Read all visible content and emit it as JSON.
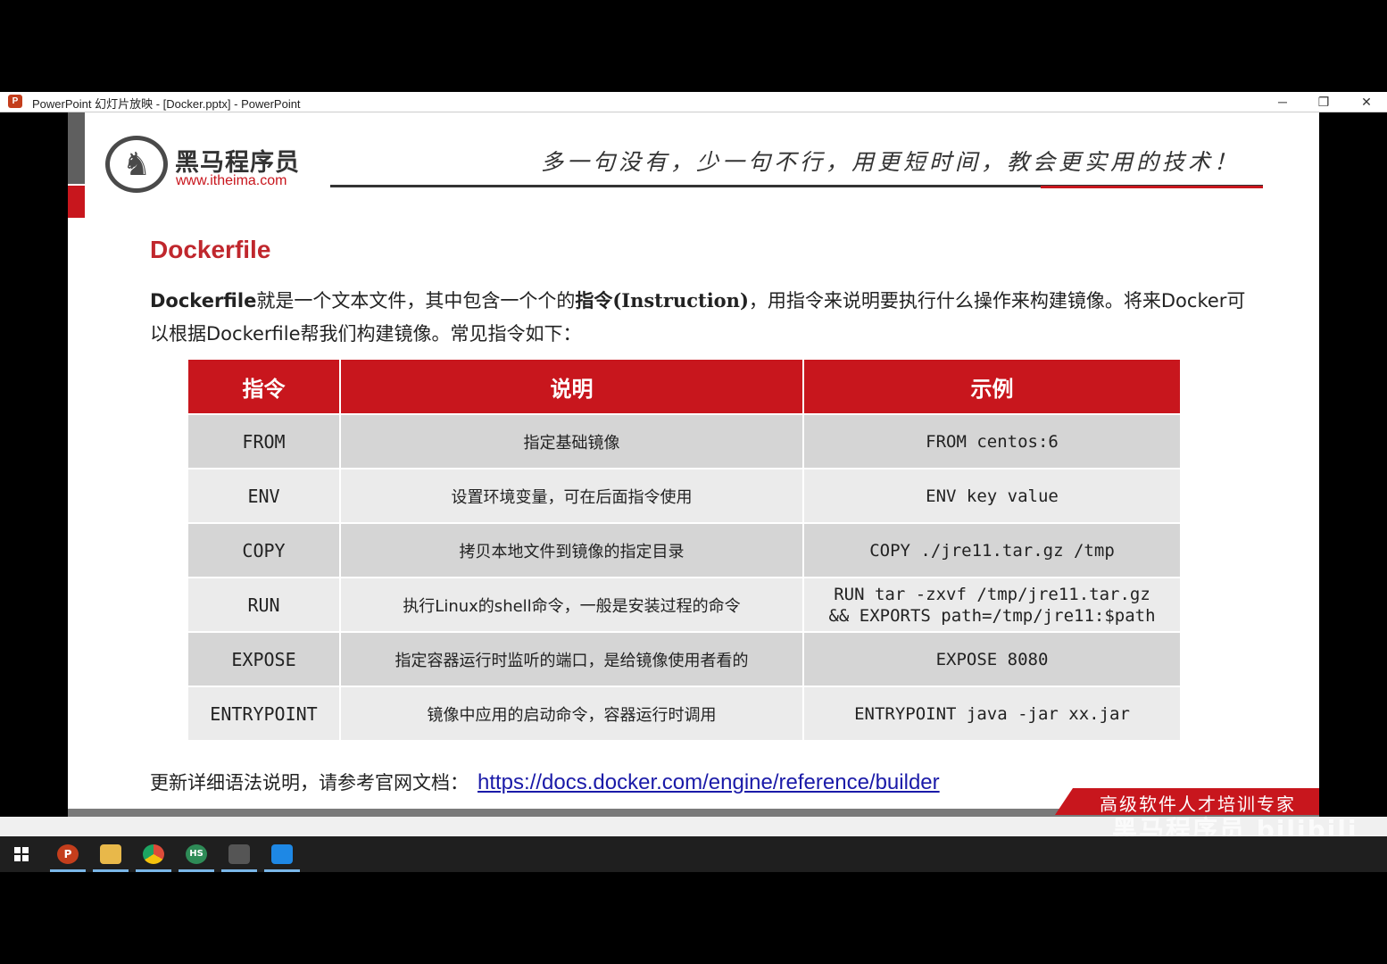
{
  "window": {
    "title": "PowerPoint 幻灯片放映 - [Docker.pptx] - PowerPoint",
    "app_icon": "P",
    "minimize": "─",
    "restore": "❐",
    "close": "✕"
  },
  "slide": {
    "logo": {
      "name_cn": "黑马程序员",
      "url": "www.itheima.com"
    },
    "slogan": "多一句没有，少一句不行，用更短时间，教会更实用的技术！",
    "heading": "Dockerfile",
    "intro": {
      "part1": "Dockerfile",
      "part2": "就是一个文本文件，其中包含一个个的",
      "part3": "指令",
      "part4": "(Instruction)",
      "part5": "，用指令来说明要执行什么操作来构建镜像。将来Docker可以根据Dockerfile帮我们构建镜像。常见指令如下："
    },
    "table": {
      "headers": [
        "指令",
        "说明",
        "示例"
      ],
      "rows": [
        {
          "cmd": "FROM",
          "desc": "指定基础镜像",
          "example": "FROM centos:6"
        },
        {
          "cmd": "ENV",
          "desc": "设置环境变量，可在后面指令使用",
          "example": "ENV key value"
        },
        {
          "cmd": "COPY",
          "desc": "拷贝本地文件到镜像的指定目录",
          "example": "COPY ./jre11.tar.gz /tmp"
        },
        {
          "cmd": "RUN",
          "desc": "执行Linux的shell命令，一般是安装过程的命令",
          "example": "RUN tar -zxvf /tmp/jre11.tar.gz\n&& EXPORTS path=/tmp/jre11:$path"
        },
        {
          "cmd": "EXPOSE",
          "desc": "指定容器运行时监听的端口，是给镜像使用者看的",
          "example": "EXPOSE 8080"
        },
        {
          "cmd": "ENTRYPOINT",
          "desc": "镜像中应用的启动命令，容器运行时调用",
          "example": "ENTRYPOINT java -jar xx.jar"
        }
      ]
    },
    "footer": {
      "note": "更新详细语法说明，请参考官网文档：",
      "link": "https://docs.docker.com/engine/reference/builder"
    },
    "banner": "高级软件人才培训专家"
  },
  "overlay": {
    "watermark": "黑马程序员 bilibili"
  },
  "taskbar": {
    "items": [
      {
        "icon": "powerpoint-icon",
        "label": "P",
        "color": "#c43e1c"
      },
      {
        "icon": "file-explorer-icon",
        "label": "",
        "color": "#e8b84a"
      },
      {
        "icon": "chrome-icon",
        "label": "",
        "color": "#dd4b39"
      },
      {
        "icon": "hbuilder-icon",
        "label": "HS",
        "color": "#2e8b57"
      },
      {
        "icon": "app-icon",
        "label": "",
        "color": "#555555"
      },
      {
        "icon": "vscode-icon",
        "label": "",
        "color": "#1e88e5"
      }
    ]
  },
  "colors": {
    "accent_red": "#c8161d",
    "heading_red": "#c0272d",
    "link_blue": "#1a1aa8"
  }
}
